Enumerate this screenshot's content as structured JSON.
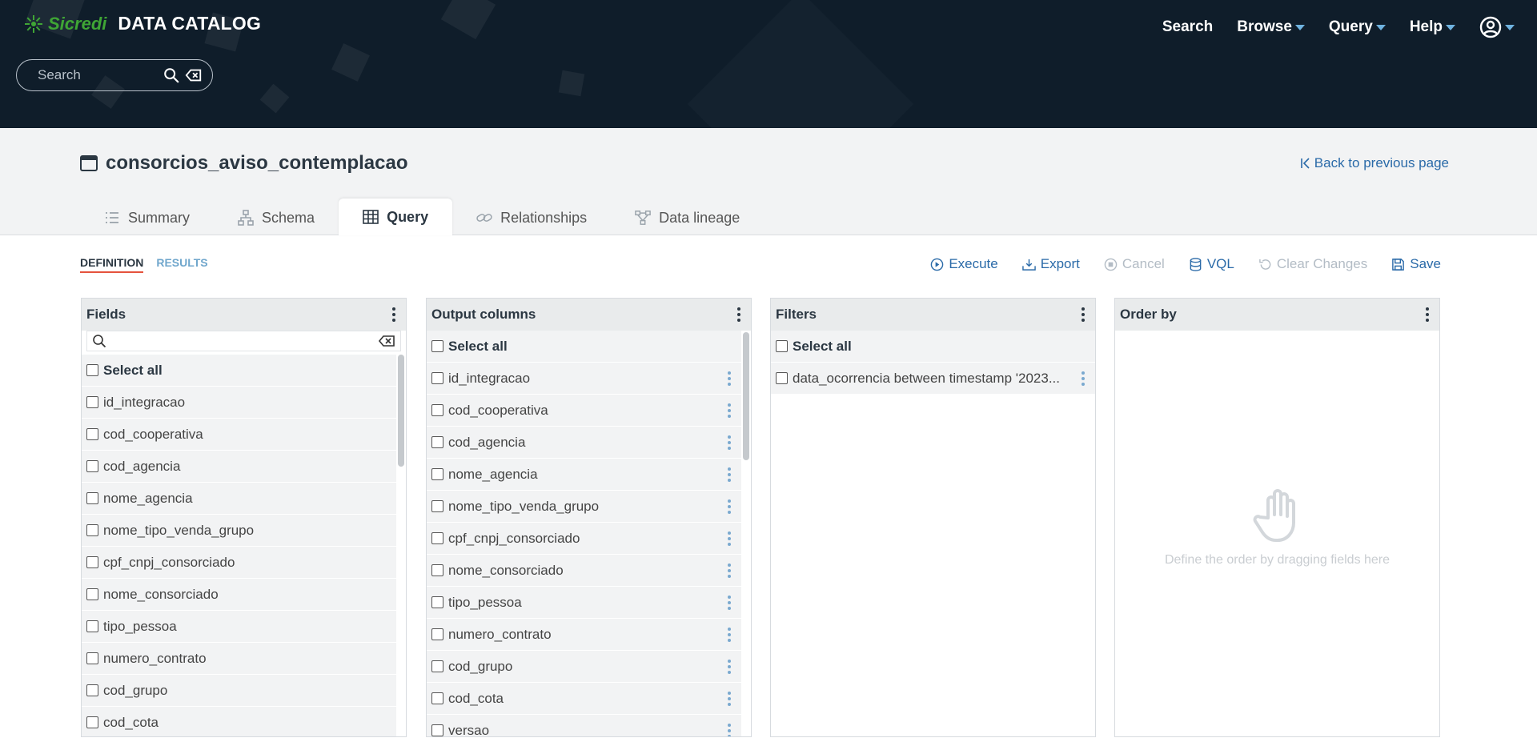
{
  "brand": {
    "name": "Sicredi",
    "app_title": "DATA CATALOG",
    "brand_color": "#3fa535"
  },
  "search": {
    "placeholder": "Search"
  },
  "topnav": {
    "search": "Search",
    "browse": "Browse",
    "query": "Query",
    "help": "Help"
  },
  "page": {
    "title": "consorcios_aviso_contemplacao",
    "back_link": "Back to previous page"
  },
  "tabs": [
    {
      "label": "Summary",
      "icon": "list-icon"
    },
    {
      "label": "Schema",
      "icon": "hierarchy-icon"
    },
    {
      "label": "Query",
      "icon": "table-icon",
      "active": true
    },
    {
      "label": "Relationships",
      "icon": "link-icon"
    },
    {
      "label": "Data lineage",
      "icon": "lineage-icon"
    }
  ],
  "subtabs": {
    "definition": "DEFINITION",
    "results": "RESULTS"
  },
  "actions": {
    "execute": "Execute",
    "export": "Export",
    "cancel": "Cancel",
    "vql": "VQL",
    "clear_changes": "Clear Changes",
    "save": "Save"
  },
  "panels": {
    "fields": {
      "title": "Fields",
      "select_all": "Select all",
      "items": [
        "id_integracao",
        "cod_cooperativa",
        "cod_agencia",
        "nome_agencia",
        "nome_tipo_venda_grupo",
        "cpf_cnpj_consorciado",
        "nome_consorciado",
        "tipo_pessoa",
        "numero_contrato",
        "cod_grupo",
        "cod_cota"
      ]
    },
    "output": {
      "title": "Output columns",
      "select_all": "Select all",
      "items": [
        "id_integracao",
        "cod_cooperativa",
        "cod_agencia",
        "nome_agencia",
        "nome_tipo_venda_grupo",
        "cpf_cnpj_consorciado",
        "nome_consorciado",
        "tipo_pessoa",
        "numero_contrato",
        "cod_grupo",
        "cod_cota",
        "versao"
      ]
    },
    "filters": {
      "title": "Filters",
      "select_all": "Select all",
      "items": [
        "data_ocorrencia between timestamp '2023..."
      ]
    },
    "order_by": {
      "title": "Order by",
      "empty_hint": "Define the order by dragging fields here"
    }
  }
}
